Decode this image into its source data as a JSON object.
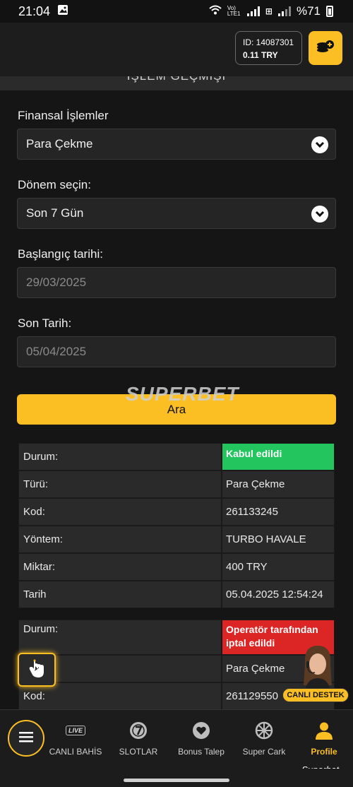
{
  "status_bar": {
    "time": "21:04",
    "network": "Vo) LTE1",
    "battery": "%71"
  },
  "header": {
    "id_label": "ID: 14087301",
    "balance": "0.11 TRY"
  },
  "page_title": "İŞLEM GEÇMİŞİ",
  "filters": {
    "financial_label": "Finansal İşlemler",
    "financial_value": "Para Çekme",
    "period_label": "Dönem seçin:",
    "period_value": "Son 7 Gün",
    "start_label": "Başlangıç tarihi:",
    "start_placeholder": "29/03/2025",
    "end_label": "Son Tarih:",
    "end_placeholder": "05/04/2025",
    "search_button": "Ara"
  },
  "watermark": "SUPERBET",
  "transactions": [
    {
      "rows": [
        {
          "key": "Durum:",
          "value": "Kabul edildi"
        },
        {
          "key": "Türü:",
          "value": "Para Çekme"
        },
        {
          "key": "Kod:",
          "value": "261133245"
        },
        {
          "key": "Yöntem:",
          "value": "TURBO HAVALE"
        },
        {
          "key": "Miktar:",
          "value": "400 TRY"
        },
        {
          "key": "Tarih",
          "value": "05.04.2025 12:54:24"
        }
      ]
    },
    {
      "rows": [
        {
          "key": "Durum:",
          "value": "Operatör tarafından iptal edildi"
        },
        {
          "key": "",
          "value": "Para Çekme"
        },
        {
          "key": "Kod:",
          "value": "261129550"
        }
      ]
    }
  ],
  "support": {
    "label": "CANLI DESTEK"
  },
  "nav": {
    "live_badge": "LIVE",
    "items": [
      {
        "label": "CANLI BAHİS"
      },
      {
        "label": "SLOTLAR"
      },
      {
        "label": "Bonus Talep"
      },
      {
        "label": "Super Cark"
      },
      {
        "label": "Profile"
      }
    ],
    "brand": "Superbet"
  },
  "colors": {
    "accent": "#fbbf24",
    "success": "#22c55e",
    "danger": "#dc2626"
  }
}
